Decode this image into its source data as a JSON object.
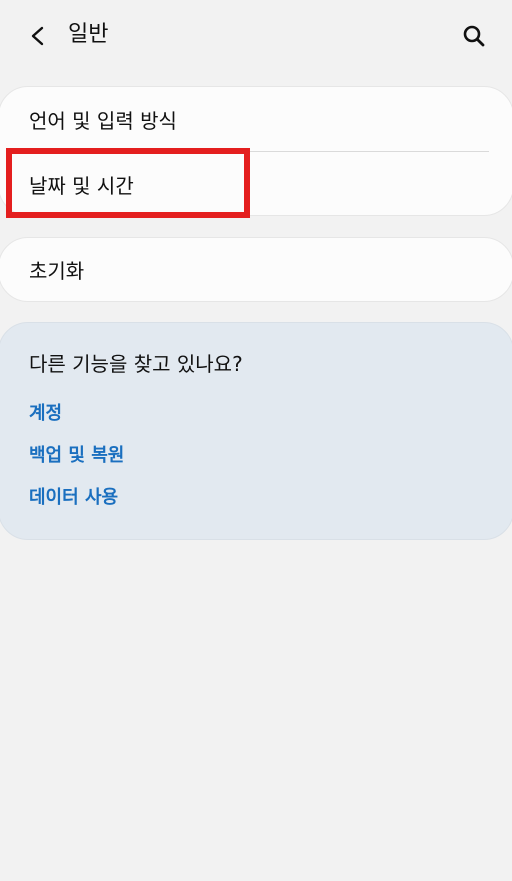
{
  "header": {
    "title": "일반",
    "back_icon": "chevron-left-icon",
    "search_icon": "search-icon"
  },
  "settings": {
    "language_input": "언어 및 입력 방식",
    "date_time": "날짜 및 시간",
    "reset": "초기화"
  },
  "suggestions": {
    "title": "다른 기능을 찾고 있나요?",
    "links": [
      "계정",
      "백업 및 복원",
      "데이터 사용"
    ]
  },
  "colors": {
    "background": "#f2f2f2",
    "card": "#fcfcfc",
    "panel": "#e2e9f0",
    "link": "#1a6fbf",
    "highlight": "#e41f1f"
  }
}
